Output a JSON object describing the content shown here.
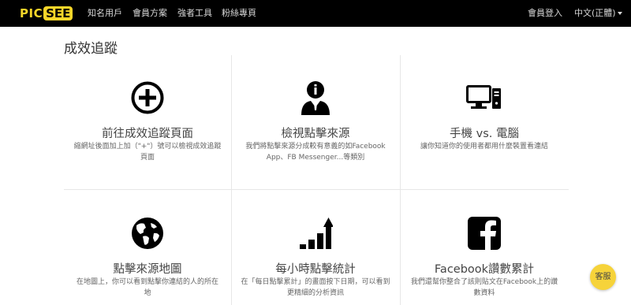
{
  "brand": {
    "logo_left": "PIC",
    "logo_right": "SEE",
    "accent": "#f7d629"
  },
  "nav": {
    "items": [
      "知名用戶",
      "會員方案",
      "強者工具",
      "粉絲專頁"
    ],
    "login": "會員登入",
    "language": "中文(正體)"
  },
  "page": {
    "title": "成效追蹤"
  },
  "cards": [
    {
      "icon": "plus-circle-icon",
      "title": "前往成效追蹤頁面",
      "desc": "縮網址後面加上加（\"+\"）號可以檢視成效追蹤頁面"
    },
    {
      "icon": "info-person-icon",
      "title": "檢視點擊來源",
      "desc": "我們將點擊來源分成較有意義的如Facebook App、FB Messenger...等類別"
    },
    {
      "icon": "desktop-computer-icon",
      "title": "手機 vs. 電腦",
      "desc": "讓你知道你的使用者都用什麼裝置看連結"
    },
    {
      "icon": "globe-icon",
      "title": "點擊來源地圖",
      "desc": "在地圖上，你可以看到點擊你連結的人的所在地"
    },
    {
      "icon": "bar-chart-up-icon",
      "title": "每小時點擊統計",
      "desc": "在「每日點擊累計」的畫面按下日期，可以看到更精細的分析資訊"
    },
    {
      "icon": "facebook-icon",
      "title": "Facebook讚數累計",
      "desc": "我們還幫你整合了該則貼文在Facebook上的讚數資料"
    }
  ],
  "support": {
    "label": "客服"
  }
}
